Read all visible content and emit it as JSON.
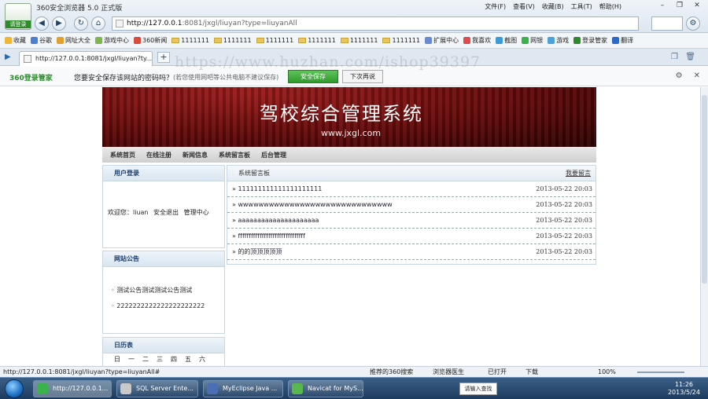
{
  "browser": {
    "title": "360安全浏览器 5.0 正式版",
    "logo_label": "请登录",
    "menus": [
      "文件(F)",
      "查看(V)",
      "收藏(B)",
      "工具(T)",
      "帮助(H)"
    ],
    "address_host": "http://127.0.0.1",
    "address_path": ":8081/jxgl/liuyan?type=liuyanAll",
    "window_buttons": [
      "–",
      "❐",
      "✕"
    ]
  },
  "bookmarks": [
    "收藏",
    "谷歌",
    "网址大全",
    "游戏中心",
    "360新闻",
    "1111111",
    "1111111",
    "1111111",
    "1111111",
    "1111111",
    "1111111",
    "扩展中心",
    "我喜欢",
    "截图",
    "网银",
    "游戏",
    "登录管家",
    "翻译"
  ],
  "tab": {
    "title": "http://127.0.0.1:8081/jxgl/liuyan?ty..."
  },
  "password_bar": {
    "brand": "360登录管家",
    "question": "您要安全保存该网站的密码吗？",
    "note": "(若您使用网吧等公共电脑不建议保存)",
    "save_label": "安全保存",
    "next_label": "下次再说"
  },
  "site": {
    "banner_title": "驾校综合管理系统",
    "banner_url": "www.jxgl.com",
    "nav": [
      "系统首页",
      "在线注册",
      "新闻信息",
      "系统留言板",
      "后台管理"
    ],
    "login_box": {
      "title": "用户登录",
      "welcome": "欢迎您：liuan",
      "logout": "安全退出",
      "admin": "管理中心"
    },
    "notice_box": {
      "title": "网站公告",
      "items": [
        "测试公告测试测试公告测试",
        "2222222222222222222222"
      ]
    },
    "calendar_box": {
      "title": "日历表",
      "weekdays": [
        "日",
        "一",
        "二",
        "三",
        "四",
        "五",
        "六"
      ]
    },
    "board": {
      "title": "系统留言板",
      "more": "我要留言",
      "rows": [
        {
          "text": "111111111111111111111",
          "date": "2013-05-22 20:03"
        },
        {
          "text": "wwwwwwwwwwwwwwwwwwwwwwwwwwwwww",
          "date": "2013-05-22 20:03"
        },
        {
          "text": "aaaaaaaaaaaaaaaaaaaaa",
          "date": "2013-05-22 20:03"
        },
        {
          "text": "fffffffffffffffffffffffffffffff",
          "date": "2013-05-22 20:03"
        },
        {
          "text": "的的顶顶顶顶顶",
          "date": "2013-05-22 20:03"
        }
      ]
    }
  },
  "statusbar": {
    "url": "http://127.0.0.1:8081/jxgl/liuyan?type=liuyanAll#",
    "search": "推荐的360搜索",
    "cleanup": "浏览器医生",
    "open": "已打开",
    "download": "下载",
    "zoom": "100%"
  },
  "taskbar": {
    "tasks": [
      "http://127.0.0.1...",
      "SQL Server Ente...",
      "MyEclipse Java ...",
      "Navicat for MyS..."
    ],
    "ime": "请输入查找",
    "time": "11:26",
    "date": "2013/5/24"
  },
  "watermark": "https://www.huzhan.com/ishop39397"
}
